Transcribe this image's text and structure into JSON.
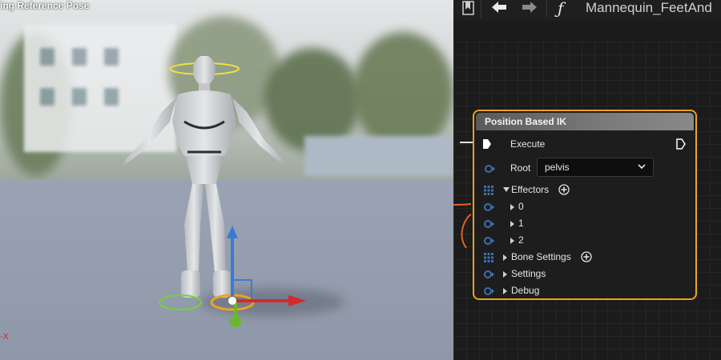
{
  "viewport": {
    "mode_label": "ing Reference Pose",
    "axis_label": "-X"
  },
  "toolbar": {
    "back_icon": "arrow-left-icon",
    "forward_icon": "arrow-right-icon",
    "function_icon": "function-icon",
    "title": "Mannequin_FeetAnd"
  },
  "node": {
    "title": "Position Based IK",
    "border_color": "#f0a020",
    "execute_label": "Execute",
    "root_label": "Root",
    "root_value": "pelvis",
    "effectors_label": "Effectors",
    "effector_items": [
      "0",
      "1",
      "2"
    ],
    "bone_settings_label": "Bone Settings",
    "settings_label": "Settings",
    "debug_label": "Debug"
  },
  "colors": {
    "pin_blue": "#3b6fb0",
    "gizmo_x": "#d42a2a",
    "gizmo_y": "#6ab72a",
    "gizmo_z": "#3a7ad6",
    "ring_yellow": "#f2e23a"
  }
}
